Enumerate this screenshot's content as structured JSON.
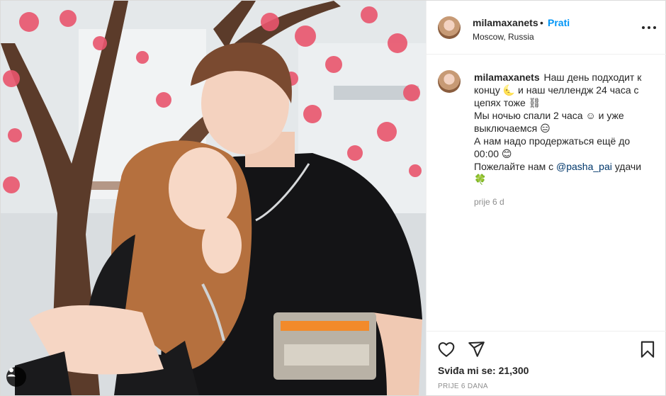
{
  "post": {
    "author": "milamaxanets",
    "separator": "•",
    "follow_label": "Prati",
    "location": "Moscow, Russia",
    "more_options_icon": "more-horizontal-icon",
    "user_tag_icon": "person-icon",
    "caption": {
      "username": "milamaxanets",
      "line1": "Наш день подходит к",
      "line2": "концу 🌜 и наш челлендж 24 часа с",
      "line3": "цепях тоже ⛓",
      "line4": "Мы ночью спали 2 часа ☺ и уже",
      "line5": "выключаемся 😑",
      "line6": "А нам надо продержаться ещё до",
      "line7": "00:00 😊",
      "line8_pre": "Пожелайте нам с ",
      "mention": "@pasha_pai",
      "line8_post": " удачи",
      "line9": "🍀",
      "time": "prije 6 d"
    },
    "actions": {
      "like_icon": "heart-icon",
      "share_icon": "paper-plane-icon",
      "save_icon": "bookmark-icon"
    },
    "likes": "Sviđa mi se: 21,300",
    "date": "PRIJE 6 DANA"
  },
  "colors": {
    "accent": "#0095f6",
    "text": "#262626",
    "muted": "#8e8e8e",
    "mention": "#00376b",
    "border": "#efefef"
  }
}
